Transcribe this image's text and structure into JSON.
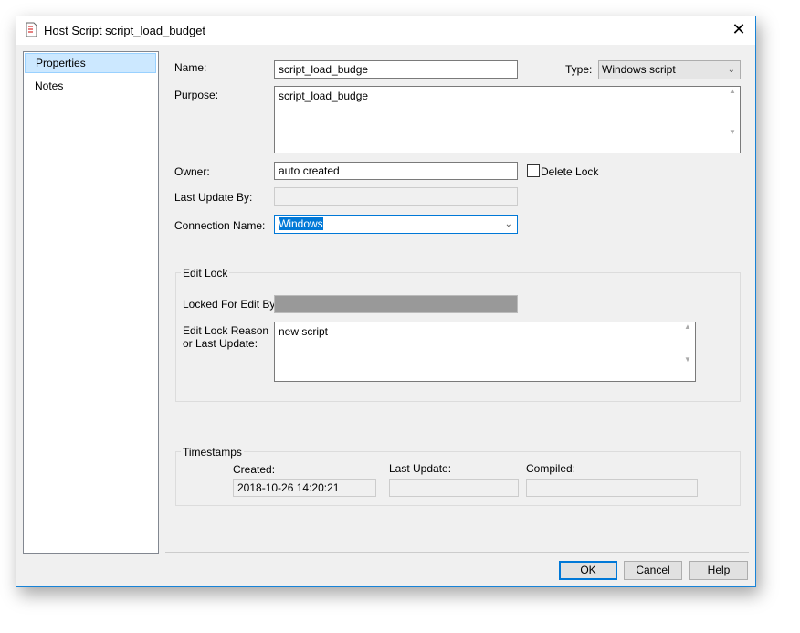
{
  "window": {
    "title": "Host Script script_load_budget",
    "close": "✕"
  },
  "sidebar": {
    "items": [
      {
        "label": "Properties"
      },
      {
        "label": "Notes"
      }
    ]
  },
  "form": {
    "name_label": "Name:",
    "name_value": "script_load_budge",
    "type_label": "Type:",
    "type_value": "Windows script",
    "purpose_label": "Purpose:",
    "purpose_value": "script_load_budge",
    "owner_label": "Owner:",
    "owner_value": "auto created",
    "delete_lock_label": "Delete Lock",
    "last_update_by_label": "Last Update By:",
    "last_update_by_value": "",
    "connection_label": "Connection Name:",
    "connection_value": "Windows"
  },
  "edit_lock": {
    "title": "Edit Lock",
    "locked_label": "Locked For Edit By:",
    "reason_label_1": "Edit Lock Reason",
    "reason_label_2": "or Last Update:",
    "reason_value": "new script"
  },
  "timestamps": {
    "title": "Timestamps",
    "created_label": "Created:",
    "created_value": "2018-10-26 14:20:21",
    "last_update_label": "Last Update:",
    "last_update_value": "",
    "compiled_label": "Compiled:",
    "compiled_value": ""
  },
  "buttons": {
    "ok": "OK",
    "cancel": "Cancel",
    "help": "Help"
  }
}
